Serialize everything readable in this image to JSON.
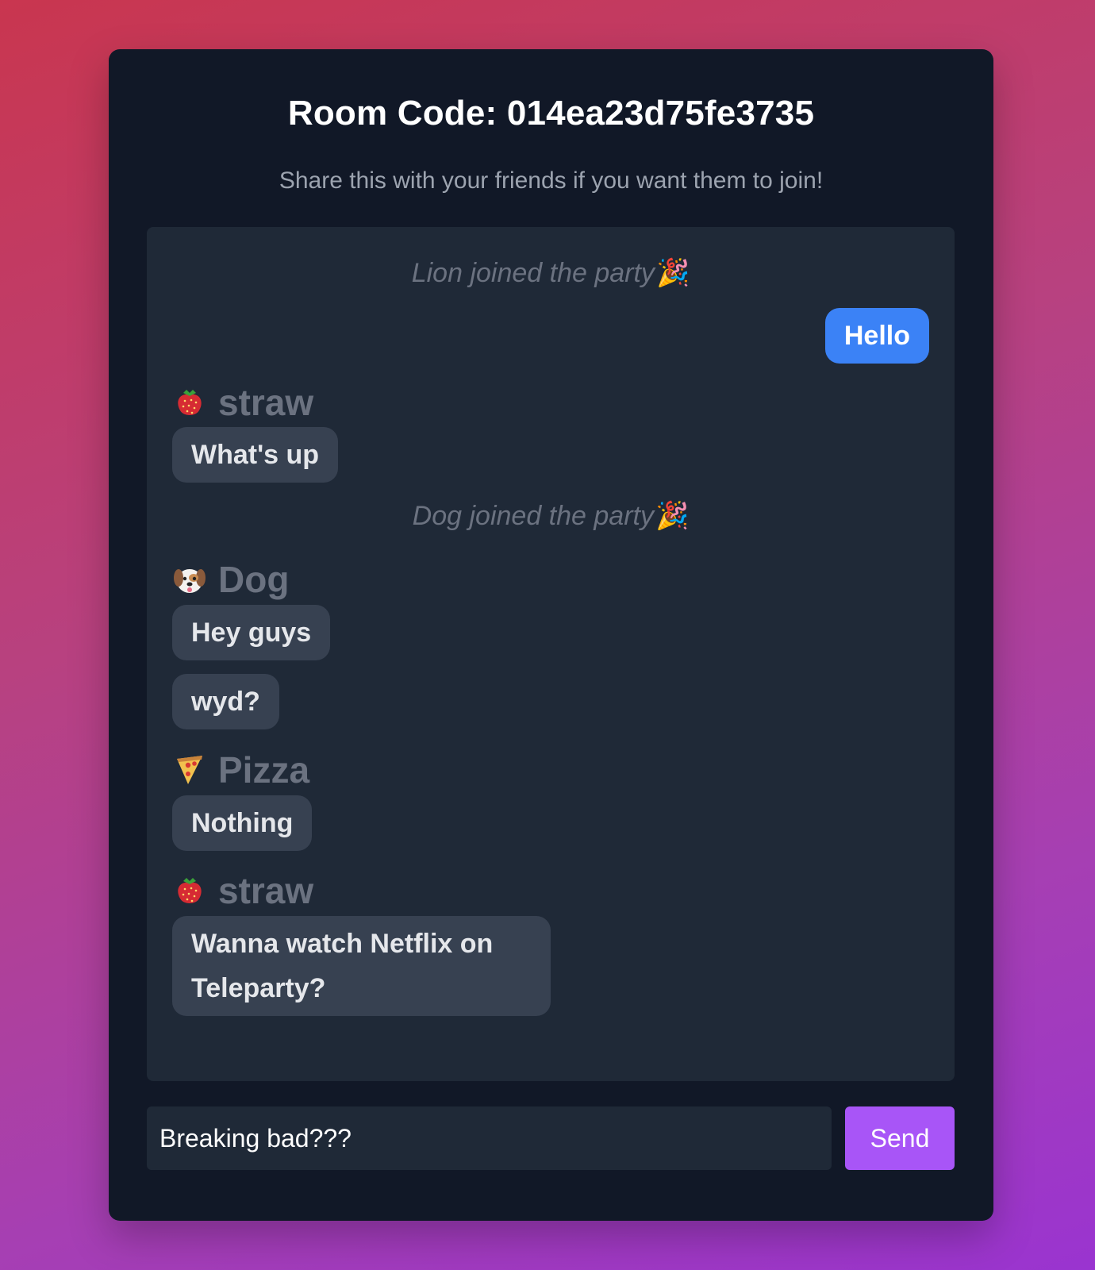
{
  "room": {
    "title": "Room Code: 014ea23d75fe3735",
    "subtitle": "Share this with your friends if you want them to join!"
  },
  "chat": {
    "system_messages": [
      {
        "text": "Lion joined the party",
        "icon": "party-popper-icon"
      },
      {
        "text": "Dog joined the party",
        "icon": "party-popper-icon"
      }
    ],
    "my_messages": [
      {
        "text": "Hello"
      }
    ],
    "senders": [
      {
        "name": "straw",
        "icon": "strawberry-icon"
      },
      {
        "name": "Dog",
        "icon": "dog-face-icon"
      },
      {
        "name": "Pizza",
        "icon": "pizza-icon"
      },
      {
        "name": "straw",
        "icon": "strawberry-icon"
      }
    ],
    "messages": [
      {
        "text": "What's up"
      },
      {
        "text": "Hey guys"
      },
      {
        "text": "wyd?"
      },
      {
        "text": "Nothing"
      },
      {
        "text": "Wanna watch Netflix on Teleparty?"
      }
    ]
  },
  "composer": {
    "value": "Breaking bad???",
    "send_label": "Send"
  },
  "colors": {
    "card_bg": "#111827",
    "chat_bg": "#1f2937",
    "bubble_bg": "#374151",
    "my_bubble_bg": "#3b82f6",
    "send_button_bg": "#a855f7"
  }
}
